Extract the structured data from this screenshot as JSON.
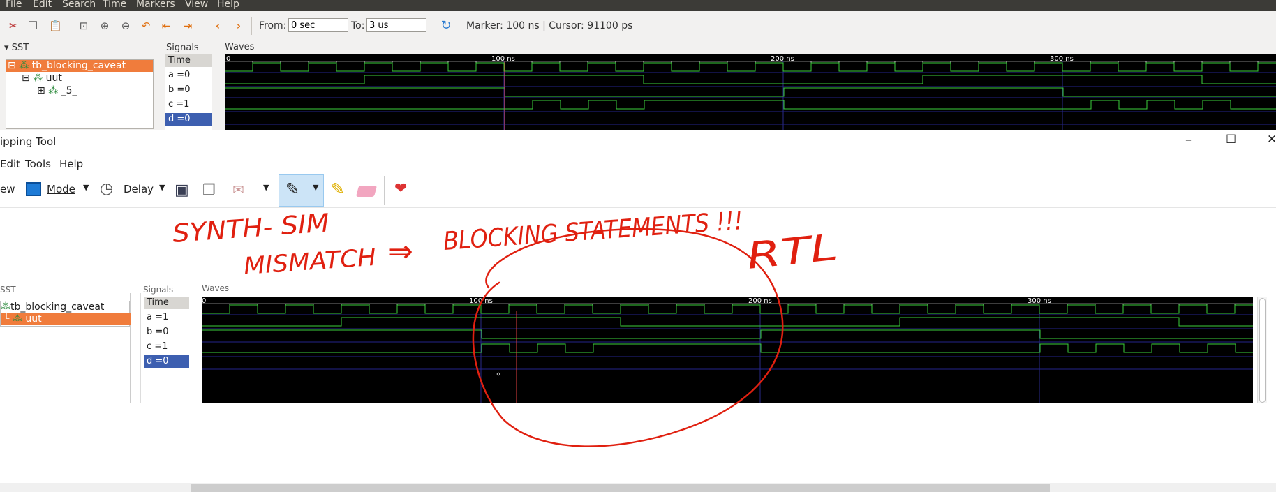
{
  "gtkwave": {
    "menu": [
      "File",
      "Edit",
      "Search",
      "Time",
      "Markers",
      "View",
      "Help"
    ],
    "from_label": "From:",
    "from_value": "0 sec",
    "to_label": "To:",
    "to_value": "3 us",
    "status": "Marker: 100 ns  |  Cursor: 91100 ps",
    "sst_title": "SST",
    "signals_title": "Signals",
    "waves_title": "Waves",
    "tree": [
      "tb_blocking_caveat",
      "uut",
      "_5_"
    ],
    "signals": [
      "Time",
      "a =0",
      "b =0",
      "c =1",
      "d =0"
    ],
    "time_labels": [
      "0",
      "100 ns",
      "200 ns",
      "300 ns"
    ]
  },
  "snipping_tool": {
    "title": "ipping Tool",
    "menu": [
      "Edit",
      "Tools",
      "Help"
    ],
    "toolbar": {
      "new": "ew",
      "mode": "Mode",
      "delay": "Delay"
    },
    "window_controls": [
      "minimize-icon",
      "maximize-icon",
      "close-icon"
    ]
  },
  "snip_capture": {
    "sst_title": "SST",
    "signals_title": "Signals",
    "waves_title": "Waves",
    "tree": [
      "tb_blocking_caveat",
      "uut"
    ],
    "signals": [
      "Time",
      "a =1",
      "b =0",
      "c =1",
      "d =0"
    ],
    "time_labels": [
      "0",
      "100 ns",
      "200 ns",
      "300 ns"
    ]
  },
  "annotation": {
    "line1": "SYNTH- SIM",
    "line2": "MISMATCH",
    "arrow": "⇒",
    "line3": "BLOCKING STATEMENTS !!!",
    "rtl": "RTL",
    "color": "#e02010"
  }
}
